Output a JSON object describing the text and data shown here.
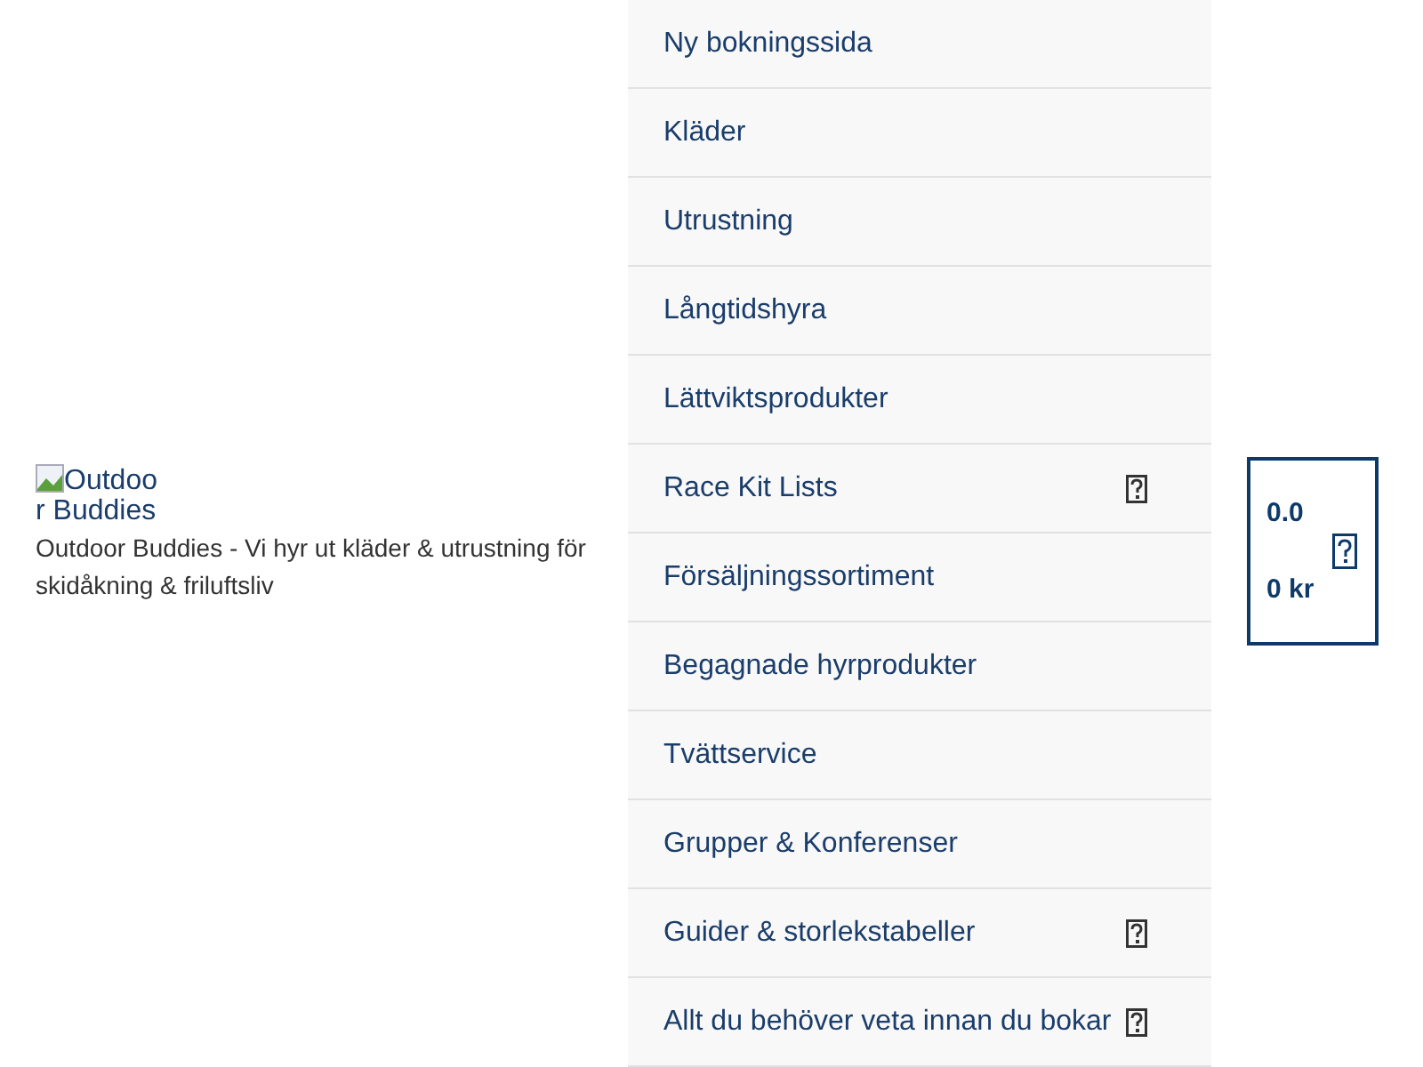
{
  "brand": {
    "logo_alt": "Outdoor Buddies",
    "tagline": "Outdoor Buddies - Vi hyr ut kläder & utrustning för skidåkning & friluftsliv"
  },
  "menu": {
    "items": [
      {
        "label": "Ny bokningssida",
        "has_icon": false
      },
      {
        "label": "Kläder",
        "has_icon": false
      },
      {
        "label": "Utrustning",
        "has_icon": false
      },
      {
        "label": "Långtidshyra",
        "has_icon": false
      },
      {
        "label": "Lättviktsprodukter",
        "has_icon": false
      },
      {
        "label": "Race Kit Lists",
        "has_icon": true
      },
      {
        "label": "Försäljningssortiment",
        "has_icon": false
      },
      {
        "label": "Begagnade hyrprodukter",
        "has_icon": false
      },
      {
        "label": "Tvättservice",
        "has_icon": false
      },
      {
        "label": "Grupper & Konferenser",
        "has_icon": false
      },
      {
        "label": "Guider & storlekstabeller",
        "has_icon": true
      },
      {
        "label": "Allt du behöver veta innan du bokar",
        "has_icon": true
      }
    ]
  },
  "cart": {
    "count": "0.0",
    "total": "0 kr"
  }
}
